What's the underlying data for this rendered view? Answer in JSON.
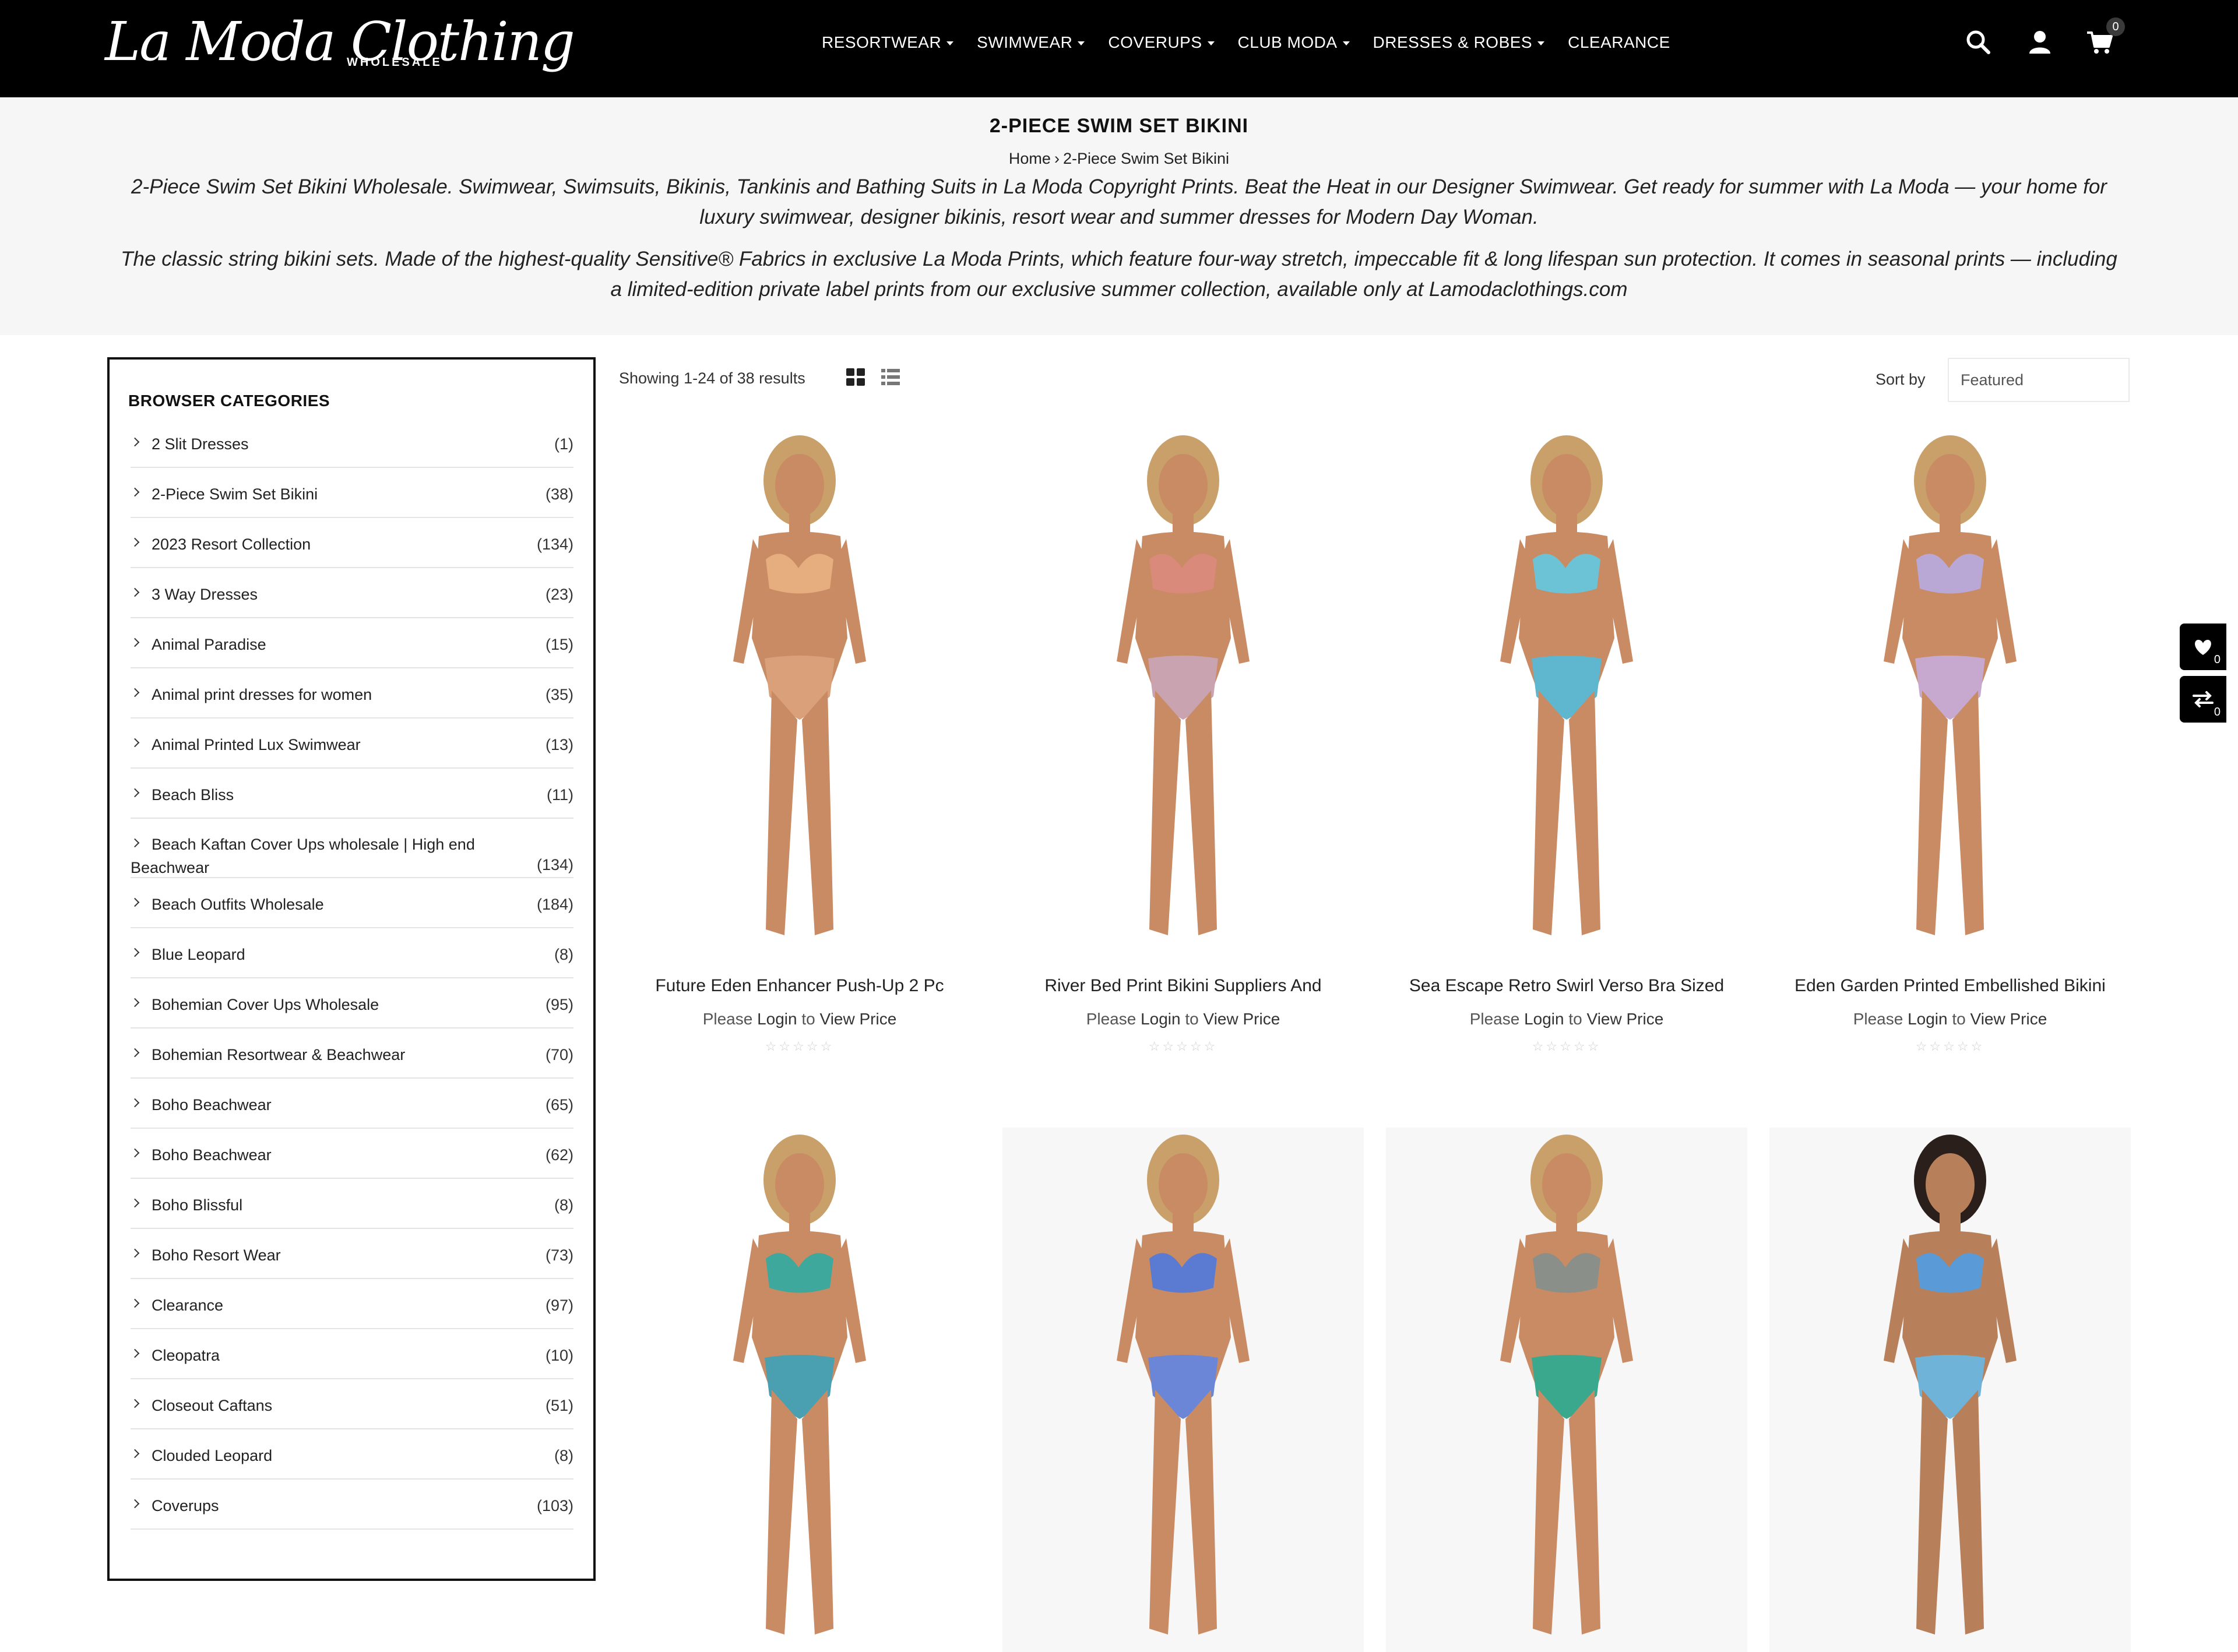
{
  "brand": {
    "logo_text": "La Moda Clothing",
    "logo_sub": "WHOLESALE"
  },
  "nav": [
    {
      "label": "RESORTWEAR",
      "dropdown": true
    },
    {
      "label": "SWIMWEAR",
      "dropdown": true
    },
    {
      "label": "COVERUPS",
      "dropdown": true
    },
    {
      "label": "CLUB MODA",
      "dropdown": true
    },
    {
      "label": "DRESSES & ROBES",
      "dropdown": true
    },
    {
      "label": "CLEARANCE",
      "dropdown": false
    }
  ],
  "header": {
    "cart_count": "0"
  },
  "banner": {
    "title": "2-PIECE SWIM SET BIKINI",
    "breadcrumb_home": "Home",
    "breadcrumb_sep": "›",
    "breadcrumb_current": "2-Piece Swim Set Bikini",
    "description_1": "2-Piece Swim Set Bikini Wholesale. Swimwear, Swimsuits, Bikinis, Tankinis and Bathing Suits in La Moda Copyright Prints. Beat the Heat in our Designer Swimwear. Get ready for summer with La Moda — your home for luxury swimwear, designer bikinis, resort wear and summer dresses for Modern Day Woman.",
    "description_2": "The classic string bikini sets. Made of the highest-quality Sensitive® Fabrics in exclusive La Moda Prints, which feature four-way stretch, impeccable fit & long lifespan sun protection. It comes in seasonal prints — including a limited-edition private label prints from our exclusive summer collection, available only at Lamodaclothings.com"
  },
  "sidebar": {
    "title": "BROWSER CATEGORIES",
    "categories": [
      {
        "name": "2 Slit Dresses",
        "count": "(1)"
      },
      {
        "name": "2-Piece Swim Set Bikini",
        "count": "(38)"
      },
      {
        "name": "2023 Resort Collection",
        "count": "(134)"
      },
      {
        "name": "3 Way Dresses",
        "count": "(23)"
      },
      {
        "name": "Animal Paradise",
        "count": "(15)"
      },
      {
        "name": "Animal print dresses for women",
        "count": "(35)"
      },
      {
        "name": "Animal Printed Lux Swimwear",
        "count": "(13)"
      },
      {
        "name": "Beach Bliss",
        "count": "(11)"
      },
      {
        "name": "Beach Kaftan Cover Ups wholesale | High end Beachwear",
        "count": "(134)"
      },
      {
        "name": "Beach Outfits Wholesale",
        "count": "(184)"
      },
      {
        "name": "Blue Leopard",
        "count": "(8)"
      },
      {
        "name": "Bohemian Cover Ups Wholesale",
        "count": "(95)"
      },
      {
        "name": "Bohemian Resortwear & Beachwear",
        "count": "(70)"
      },
      {
        "name": "Boho Beachwear",
        "count": "(65)"
      },
      {
        "name": "Boho Beachwear",
        "count": "(62)"
      },
      {
        "name": "Boho Blissful",
        "count": "(8)"
      },
      {
        "name": "Boho Resort Wear",
        "count": "(73)"
      },
      {
        "name": "Clearance",
        "count": "(97)"
      },
      {
        "name": "Cleopatra",
        "count": "(10)"
      },
      {
        "name": "Closeout Caftans",
        "count": "(51)"
      },
      {
        "name": "Clouded Leopard",
        "count": "(8)"
      },
      {
        "name": "Coverups",
        "count": "(103)"
      }
    ]
  },
  "toolbar": {
    "results_text": "Showing 1-24 of 38 results",
    "sort_label": "Sort by",
    "sort_value": "Featured"
  },
  "products": [
    {
      "name": "Future Eden Enhancer Push-Up 2 Pc",
      "price_prefix": "Please ",
      "login": "Login",
      "price_mid": " to ",
      "view": "View Price",
      "top": "#e6ad7e",
      "bottom": "#d9a07a",
      "skin": "#c98b63",
      "hair": "#c9a06a"
    },
    {
      "name": "River Bed Print Bikini Suppliers And",
      "price_prefix": "Please ",
      "login": "Login",
      "price_mid": " to ",
      "view": "View Price",
      "top": "#d98a7a",
      "bottom": "#c9a3b0",
      "skin": "#c98b63",
      "hair": "#c9a06a"
    },
    {
      "name": "Sea Escape Retro Swirl Verso Bra Sized",
      "price_prefix": "Please ",
      "login": "Login",
      "price_mid": " to ",
      "view": "View Price",
      "top": "#6cc3d6",
      "bottom": "#5fb6cf",
      "skin": "#c98b63",
      "hair": "#c9a06a"
    },
    {
      "name": "Eden Garden Printed Embellished Bikini",
      "price_prefix": "Please ",
      "login": "Login",
      "price_mid": " to ",
      "view": "View Price",
      "top": "#b9a8d6",
      "bottom": "#c7a9cf",
      "skin": "#c98b63",
      "hair": "#c9a06a"
    },
    {
      "name": "",
      "price_prefix": "",
      "login": "",
      "price_mid": "",
      "view": "",
      "top": "#3fa89c",
      "bottom": "#4a9fb0",
      "skin": "#c98b63",
      "hair": "#c9a06a"
    },
    {
      "name": "",
      "price_prefix": "",
      "login": "",
      "price_mid": "",
      "view": "",
      "top": "#5a7bd1",
      "bottom": "#6b86d6",
      "skin": "#c98b63",
      "hair": "#c9a06a"
    },
    {
      "name": "",
      "price_prefix": "",
      "login": "",
      "price_mid": "",
      "view": "",
      "top": "#8a8f8a",
      "bottom": "#3aa88c",
      "skin": "#c98b63",
      "hair": "#c9a06a"
    },
    {
      "name": "",
      "price_prefix": "",
      "login": "",
      "price_mid": "",
      "view": "",
      "top": "#5a9ad6",
      "bottom": "#6fb3d9",
      "skin": "#b8805a",
      "hair": "#2a1f1a"
    }
  ],
  "floating": {
    "wishlist_count": "0",
    "compare_count": "0"
  },
  "colors": {
    "header_bg": "#000000",
    "banner_bg": "#f6f6f6",
    "accent": "#000000"
  }
}
